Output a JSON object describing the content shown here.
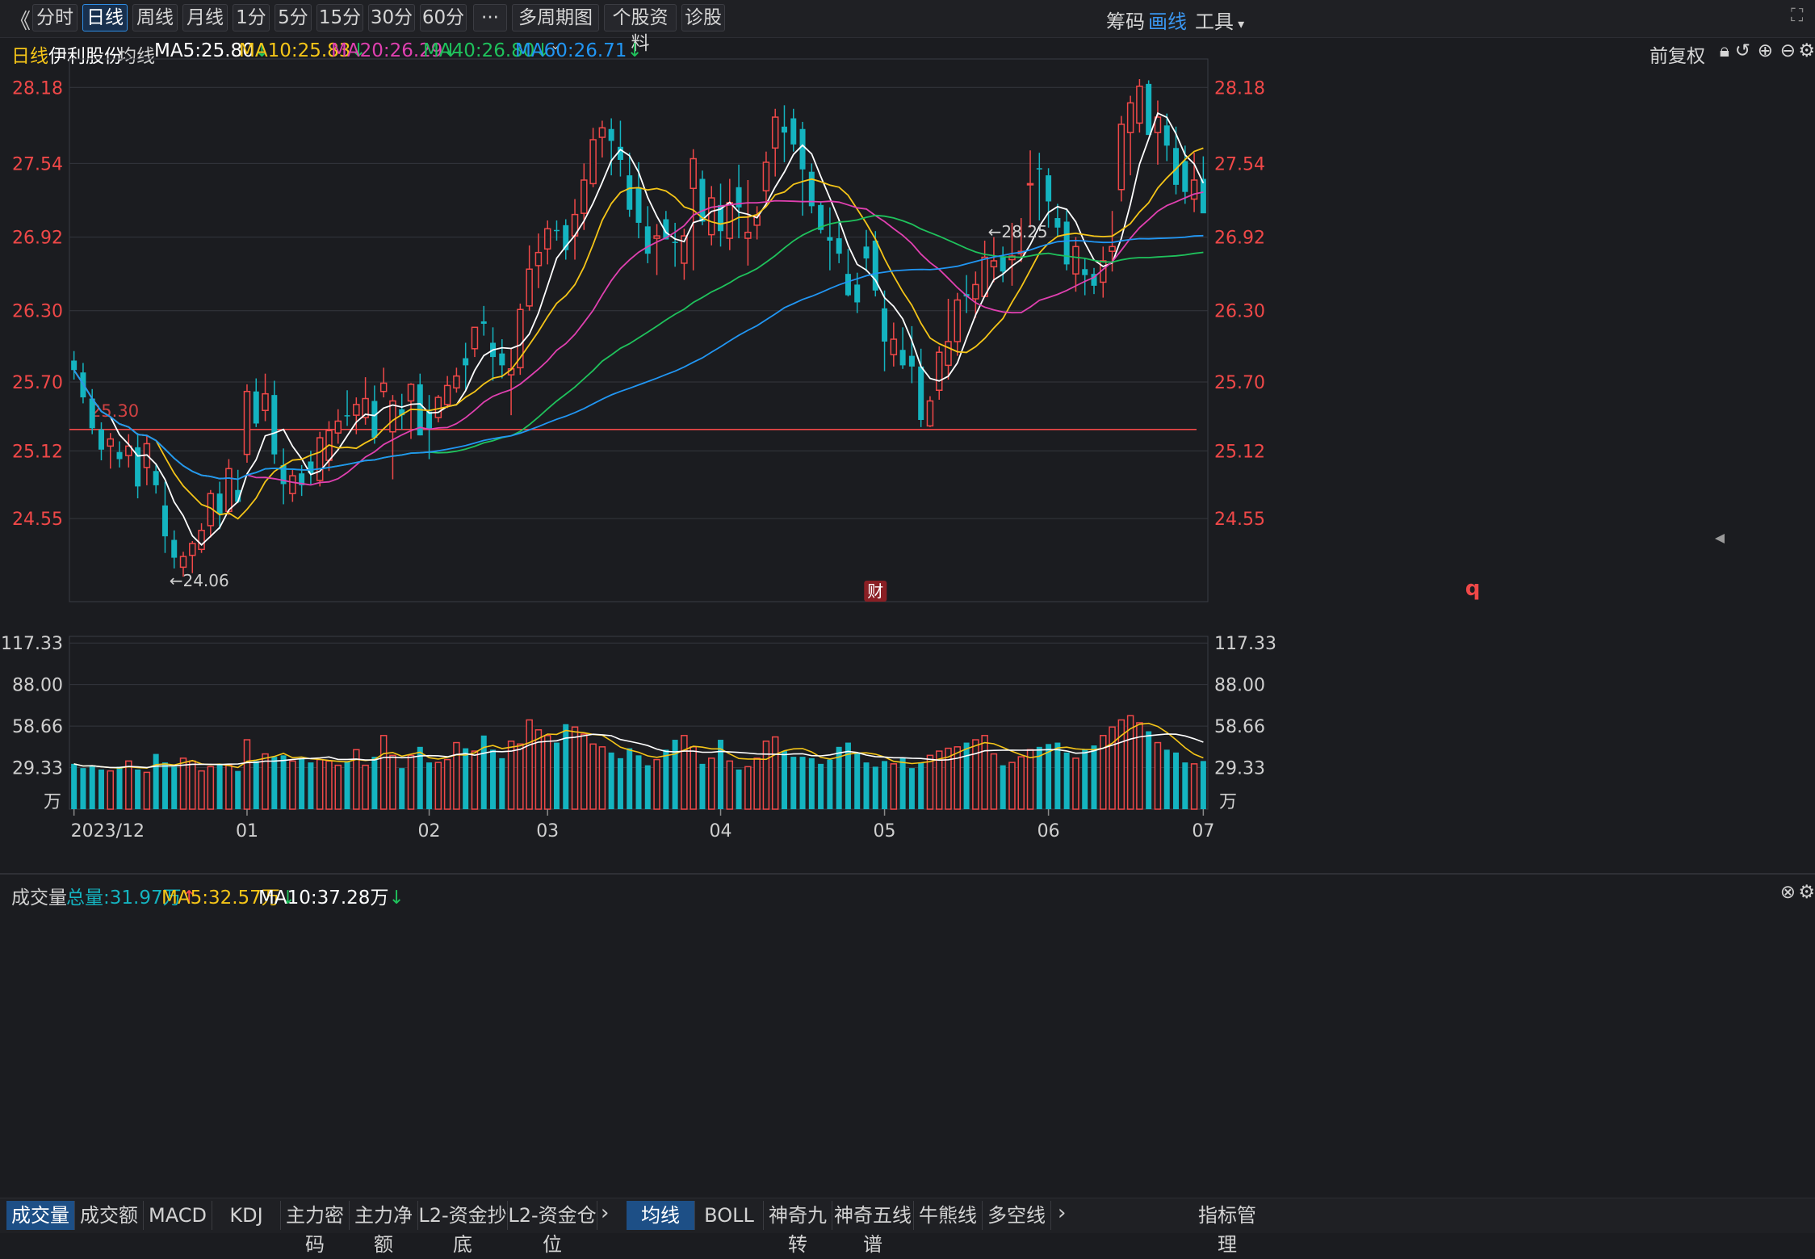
{
  "toolbar": {
    "back_icon": "double-chevron-left-icon",
    "periods": [
      "分时",
      "日线",
      "周线",
      "月线",
      "1分",
      "5分",
      "15分",
      "30分",
      "60分"
    ],
    "active_period": "日线",
    "more_label": "···",
    "multi_period_label": "多周期图",
    "stock_info_label": "个股资料",
    "diagnose_label": "诊股",
    "chips_label": "筹码",
    "draw_label": "画线",
    "tools_label": "工具"
  },
  "legend": {
    "period": "日线",
    "stock": "伊利股份",
    "ma_title": "均线",
    "ma5": "MA5:25.80",
    "ma10": "MA10:25.83",
    "ma20": "MA20:26.29",
    "ma40": "MA40:26.80",
    "ma60": "MA60:26.71",
    "adjust_label": "前复权"
  },
  "colors": {
    "up": "#f04848",
    "down": "#14b4c0",
    "ma5": "#ffffff",
    "ma10": "#f5c518",
    "ma20": "#e040b0",
    "ma40": "#1fc25c",
    "ma60": "#2196f3",
    "grid": "#34363d",
    "price_label": "#f04848",
    "axis_text": "#cfcfcf"
  },
  "volume_legend": {
    "title": "成交量",
    "total": "总量:31.97万",
    "ma5": "MA5:32.57万",
    "ma10": "MA10:37.28万"
  },
  "chart_data": {
    "type": "candlestick",
    "price_axis": {
      "ylim": [
        23.85,
        28.42
      ],
      "ticks": [
        "28.18",
        "27.54",
        "26.92",
        "26.30",
        "25.70",
        "25.12",
        "24.55"
      ]
    },
    "volume_axis": {
      "ylim": [
        0,
        122
      ],
      "unit": "万",
      "ticks": [
        "117.33",
        "88.00",
        "58.66",
        "29.33"
      ]
    },
    "x_labels": [
      {
        "label": "2023/12",
        "index": 0
      },
      {
        "label": "01",
        "index": 19
      },
      {
        "label": "02",
        "index": 39
      },
      {
        "label": "03",
        "index": 52
      },
      {
        "label": "04",
        "index": 71
      },
      {
        "label": "05",
        "index": 89
      },
      {
        "label": "06",
        "index": 107
      },
      {
        "label": "07",
        "index": 124
      }
    ],
    "annotations": {
      "high_label": "←28.25",
      "high_index": 100,
      "low_label": "←24.06",
      "low_index": 11,
      "level_line": 25.3,
      "level_label": "25.30",
      "finance_tag": "财",
      "finance_index": 88,
      "q_tag": "q"
    },
    "candles": [
      [
        25.88,
        25.96,
        25.72,
        25.8
      ],
      [
        25.78,
        25.86,
        25.52,
        25.57
      ],
      [
        25.56,
        25.64,
        25.26,
        25.31
      ],
      [
        25.3,
        25.36,
        25.04,
        25.13
      ],
      [
        25.16,
        25.27,
        24.97,
        25.22
      ],
      [
        25.11,
        25.2,
        24.98,
        25.05
      ],
      [
        25.08,
        25.26,
        24.98,
        25.16
      ],
      [
        25.15,
        25.27,
        24.72,
        24.82
      ],
      [
        24.98,
        25.25,
        24.83,
        25.18
      ],
      [
        24.95,
        25.01,
        24.76,
        24.83
      ],
      [
        24.66,
        24.86,
        24.26,
        24.4
      ],
      [
        24.37,
        24.45,
        24.13,
        24.22
      ],
      [
        24.14,
        24.27,
        24.06,
        24.23
      ],
      [
        24.24,
        24.36,
        24.09,
        24.34
      ],
      [
        24.29,
        24.51,
        24.26,
        24.45
      ],
      [
        24.49,
        24.79,
        24.39,
        24.76
      ],
      [
        24.76,
        24.86,
        24.46,
        24.59
      ],
      [
        24.61,
        25.05,
        24.58,
        24.97
      ],
      [
        24.79,
        24.96,
        24.68,
        24.69
      ],
      [
        25.09,
        25.68,
        25.02,
        25.62
      ],
      [
        25.62,
        25.73,
        25.32,
        25.35
      ],
      [
        25.46,
        25.77,
        25.37,
        25.6
      ],
      [
        25.59,
        25.71,
        25.01,
        25.09
      ],
      [
        25.0,
        25.14,
        24.67,
        24.84
      ],
      [
        24.76,
        24.97,
        24.69,
        24.91
      ],
      [
        24.93,
        25.0,
        24.74,
        24.83
      ],
      [
        25.03,
        25.12,
        24.84,
        24.93
      ],
      [
        24.87,
        25.28,
        24.82,
        25.23
      ],
      [
        25.04,
        25.37,
        24.95,
        25.29
      ],
      [
        25.27,
        25.47,
        25.18,
        25.37
      ],
      [
        25.42,
        25.63,
        25.33,
        25.41
      ],
      [
        25.42,
        25.57,
        25.26,
        25.51
      ],
      [
        25.4,
        25.74,
        25.34,
        25.56
      ],
      [
        25.54,
        25.67,
        25.18,
        25.23
      ],
      [
        25.62,
        25.82,
        25.57,
        25.69
      ],
      [
        25.28,
        25.59,
        24.88,
        25.54
      ],
      [
        25.47,
        25.6,
        25.3,
        25.42
      ],
      [
        25.54,
        25.69,
        25.22,
        25.68
      ],
      [
        25.68,
        25.77,
        25.25,
        25.25
      ],
      [
        25.45,
        25.59,
        25.05,
        25.3
      ],
      [
        25.4,
        25.59,
        25.36,
        25.57
      ],
      [
        25.51,
        25.75,
        25.48,
        25.67
      ],
      [
        25.65,
        25.82,
        25.61,
        25.75
      ],
      [
        25.9,
        26.03,
        25.63,
        25.84
      ],
      [
        25.98,
        26.16,
        25.91,
        26.16
      ],
      [
        26.21,
        26.34,
        26.09,
        26.19
      ],
      [
        26.03,
        26.16,
        25.71,
        25.91
      ],
      [
        25.94,
        26.06,
        25.73,
        25.84
      ],
      [
        25.76,
        25.98,
        25.42,
        25.81
      ],
      [
        25.82,
        26.36,
        25.76,
        26.31
      ],
      [
        26.34,
        26.85,
        26.3,
        26.65
      ],
      [
        26.68,
        26.95,
        26.49,
        26.79
      ],
      [
        26.82,
        27.06,
        26.69,
        26.99
      ],
      [
        26.98,
        27.06,
        26.89,
        26.97
      ],
      [
        27.02,
        27.07,
        26.73,
        26.81
      ],
      [
        26.93,
        27.24,
        26.73,
        27.11
      ],
      [
        27.12,
        27.54,
        26.98,
        27.4
      ],
      [
        27.37,
        27.84,
        27.34,
        27.74
      ],
      [
        27.76,
        27.9,
        27.59,
        27.84
      ],
      [
        27.83,
        27.92,
        27.44,
        27.73
      ],
      [
        27.68,
        27.9,
        27.43,
        27.57
      ],
      [
        27.44,
        27.63,
        27.09,
        27.15
      ],
      [
        27.34,
        27.55,
        26.91,
        27.04
      ],
      [
        27.01,
        27.18,
        26.7,
        26.78
      ],
      [
        26.91,
        27.03,
        26.6,
        26.93
      ],
      [
        27.07,
        27.14,
        26.96,
        26.9
      ],
      [
        26.88,
        27.04,
        26.67,
        26.87
      ],
      [
        26.7,
        26.99,
        26.56,
        26.93
      ],
      [
        27.33,
        27.66,
        26.64,
        27.58
      ],
      [
        27.41,
        27.48,
        27.02,
        27.05
      ],
      [
        26.94,
        27.35,
        26.85,
        27.25
      ],
      [
        27.19,
        27.37,
        26.84,
        26.97
      ],
      [
        26.91,
        27.41,
        26.81,
        27.21
      ],
      [
        27.34,
        27.53,
        26.91,
        27.17
      ],
      [
        26.91,
        27.4,
        26.68,
        26.96
      ],
      [
        27.02,
        27.18,
        26.9,
        27.1
      ],
      [
        27.31,
        27.64,
        27.22,
        27.55
      ],
      [
        27.67,
        28.0,
        27.43,
        27.93
      ],
      [
        27.85,
        28.03,
        27.55,
        27.8
      ],
      [
        27.92,
        28.0,
        27.64,
        27.7
      ],
      [
        27.83,
        27.89,
        27.1,
        27.49
      ],
      [
        27.47,
        27.54,
        27.12,
        27.18
      ],
      [
        27.19,
        27.22,
        26.95,
        26.98
      ],
      [
        26.92,
        27.17,
        26.64,
        26.89
      ],
      [
        26.91,
        27.06,
        26.7,
        26.78
      ],
      [
        26.61,
        26.82,
        26.42,
        26.43
      ],
      [
        26.52,
        26.62,
        26.28,
        26.37
      ],
      [
        26.84,
        26.98,
        26.63,
        26.74
      ],
      [
        26.89,
        26.97,
        26.42,
        26.47
      ],
      [
        26.32,
        26.47,
        25.79,
        26.04
      ],
      [
        25.93,
        26.2,
        25.83,
        26.06
      ],
      [
        25.97,
        26.16,
        25.81,
        25.84
      ],
      [
        25.92,
        26.17,
        25.69,
        25.83
      ],
      [
        25.83,
        25.98,
        25.32,
        25.38
      ],
      [
        25.33,
        25.58,
        25.32,
        25.54
      ],
      [
        25.63,
        26.0,
        25.55,
        25.95
      ],
      [
        25.84,
        26.4,
        25.72,
        26.04
      ],
      [
        26.04,
        26.45,
        25.92,
        26.39
      ],
      [
        26.44,
        26.6,
        26.28,
        26.42
      ],
      [
        26.4,
        26.63,
        26.24,
        26.52
      ],
      [
        26.42,
        26.89,
        26.45,
        26.75
      ],
      [
        26.67,
        26.92,
        26.54,
        26.72
      ],
      [
        26.75,
        26.84,
        26.54,
        26.63
      ],
      [
        26.73,
        27.04,
        26.51,
        26.76
      ],
      [
        26.78,
        27.08,
        26.71,
        26.8
      ],
      [
        27.37,
        27.65,
        27.0,
        27.37
      ],
      [
        27.5,
        27.63,
        27.06,
        27.49
      ],
      [
        27.44,
        27.5,
        27.0,
        27.22
      ],
      [
        27.08,
        27.2,
        26.92,
        27.0
      ],
      [
        27.05,
        27.16,
        26.64,
        26.69
      ],
      [
        26.61,
        26.92,
        26.46,
        26.84
      ],
      [
        26.65,
        26.74,
        26.43,
        26.6
      ],
      [
        26.61,
        26.66,
        26.44,
        26.51
      ],
      [
        26.54,
        26.84,
        26.41,
        26.72
      ],
      [
        26.8,
        27.14,
        26.63,
        26.84
      ],
      [
        27.32,
        27.94,
        27.22,
        27.87
      ],
      [
        27.8,
        28.11,
        27.44,
        28.05
      ],
      [
        27.88,
        28.25,
        27.8,
        28.19
      ],
      [
        28.21,
        28.24,
        27.84,
        27.78
      ],
      [
        27.8,
        28.07,
        27.53,
        27.93
      ],
      [
        27.86,
        27.96,
        27.56,
        27.69
      ],
      [
        27.67,
        27.85,
        27.28,
        27.36
      ],
      [
        27.56,
        27.69,
        27.2,
        27.3
      ],
      [
        27.24,
        27.63,
        27.13,
        27.4
      ],
      [
        27.41,
        27.6,
        27.24,
        27.12
      ]
    ],
    "volumes": [
      32,
      29,
      31,
      28,
      27,
      30,
      34,
      28,
      26,
      39,
      33,
      30,
      36,
      34,
      27,
      30,
      32,
      31,
      27,
      49,
      34,
      39,
      37,
      38,
      34,
      36,
      33,
      35,
      34,
      31,
      34,
      42,
      31,
      37,
      52,
      38,
      29,
      38,
      44,
      33,
      33,
      35,
      47,
      43,
      41,
      52,
      42,
      36,
      48,
      46,
      63,
      56,
      52,
      47,
      60,
      58,
      53,
      46,
      44,
      40,
      36,
      43,
      38,
      31,
      35,
      42,
      49,
      52,
      44,
      32,
      36,
      49,
      34,
      28,
      30,
      36,
      48,
      51,
      41,
      37,
      37,
      36,
      32,
      35,
      44,
      47,
      40,
      33,
      30,
      34,
      32,
      36,
      29,
      33,
      38,
      41,
      43,
      44,
      47,
      49,
      52,
      39,
      31,
      33,
      37,
      42,
      44,
      46,
      47,
      40,
      36,
      42,
      45,
      52,
      58,
      63,
      66,
      61,
      55,
      47,
      42,
      40,
      33,
      32,
      34,
      31
    ],
    "series": [
      {
        "name": "MA5",
        "period": 5
      },
      {
        "name": "MA10",
        "period": 10
      },
      {
        "name": "MA20",
        "period": 20
      },
      {
        "name": "MA40",
        "period": 40
      },
      {
        "name": "MA60",
        "period": 60
      }
    ]
  },
  "bottom_tabs_left": [
    "成交量",
    "成交额",
    "MACD",
    "KDJ",
    "主力密码",
    "主力净额",
    "L2-资金抄底",
    "L2-资金仓位"
  ],
  "bottom_tabs_right": [
    "均线",
    "BOLL",
    "神奇九转",
    "神奇五线谱",
    "牛熊线",
    "多空线"
  ],
  "indicator_manage": "指标管理"
}
